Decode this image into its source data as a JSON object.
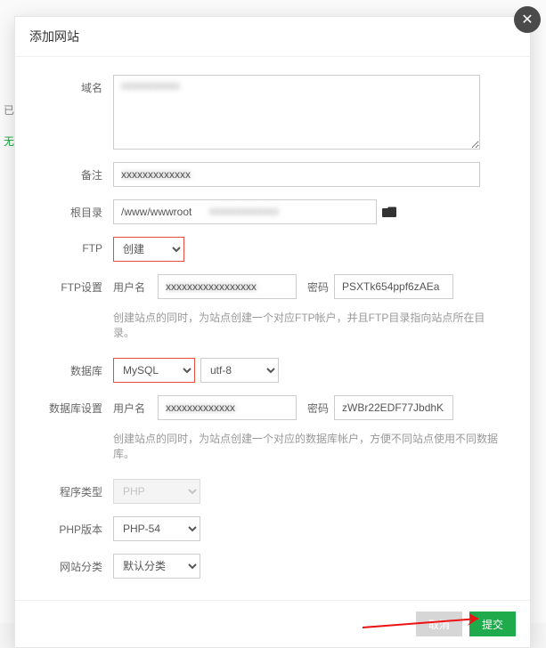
{
  "bg": {
    "t1": "已备",
    "t2": "无"
  },
  "title": "添加网站",
  "labels": {
    "domain": "域名",
    "remark": "备注",
    "root": "根目录",
    "ftp": "FTP",
    "ftpset": "FTP设置",
    "db": "数据库",
    "dbset": "数据库设置",
    "ptype": "程序类型",
    "phpver": "PHP版本",
    "cat": "网站分类"
  },
  "domain": {
    "value": "xxxxxxxxxxx"
  },
  "remark": {
    "value": "xxxxxxxxxxxxx"
  },
  "root": {
    "value": "/www/wwwroot",
    "mask": "xxxxxxxxxxxxx"
  },
  "ftp": {
    "selected": "创建"
  },
  "ftpset": {
    "userLabel": "用户名",
    "userValue": "xxxxxxxxxxxxxxxxx",
    "pwdLabel": "密码",
    "pwdValue": "PSXTk654ppf6zAEa",
    "hint": "创建站点的同时，为站点创建一个对应FTP帐户，并且FTP目录指向站点所在目录。"
  },
  "db": {
    "selected": "MySQL",
    "encoding": "utf-8"
  },
  "dbset": {
    "userLabel": "用户名",
    "userValue": "xxxxxxxxxxxxx",
    "pwdLabel": "密码",
    "pwdValue": "zWBr22EDF77JbdhK",
    "hint": "创建站点的同时，为站点创建一个对应的数据库帐户，方便不同站点使用不同数据库。"
  },
  "ptype": {
    "selected": "PHP"
  },
  "phpver": {
    "selected": "PHP-54"
  },
  "cat": {
    "selected": "默认分类"
  },
  "footer": {
    "cancel": "取消",
    "submit": "提交"
  }
}
